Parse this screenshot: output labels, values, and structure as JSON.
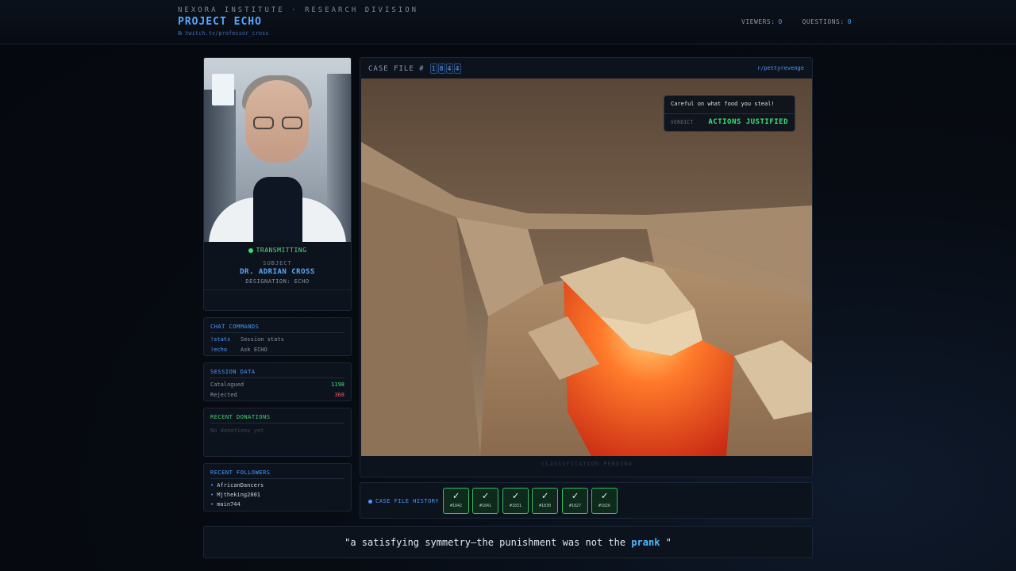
{
  "header": {
    "org": "NEXORA INSTITUTE · RESEARCH DIVISION",
    "project": "PROJECT ECHO",
    "channel": "twitch.tv/professor_cross",
    "viewers_label": "VIEWERS:",
    "viewers": "0",
    "questions_label": "QUESTIONS:",
    "questions": "0"
  },
  "subject": {
    "status": "TRANSMITTING",
    "label": "SUBJECT",
    "name": "DR. ADRIAN CROSS",
    "designation": "DESIGNATION: ECHO"
  },
  "chat_commands": {
    "title": "CHAT COMMANDS",
    "items": [
      {
        "cmd": "!stats",
        "desc": "Session stats"
      },
      {
        "cmd": "!echo",
        "desc": "Ask ECHO"
      }
    ]
  },
  "session_data": {
    "title": "SESSION DATA",
    "catalogued_label": "Catalogued",
    "catalogued": "1198",
    "rejected_label": "Rejected",
    "rejected": "368"
  },
  "donations": {
    "title": "RECENT DONATIONS",
    "empty": "No donations yet"
  },
  "followers": {
    "title": "RECENT FOLLOWERS",
    "items": [
      "AfricanDancers",
      "Mjtheking2001",
      "main744"
    ]
  },
  "case_file": {
    "label": "CASE FILE #",
    "digits": [
      "1",
      "8",
      "4",
      "4"
    ],
    "subreddit": "r/pettyrevenge",
    "quote": "Careful on what food you steal!",
    "verdict_label": "VERDICT",
    "verdict": "ACTIONS JUSTIFIED",
    "footer": "CLASSIFICATION PENDING"
  },
  "history": {
    "label": "CASE FILE HISTORY",
    "items": [
      {
        "check": "✓",
        "id": "#1842"
      },
      {
        "check": "✓",
        "id": "#1841"
      },
      {
        "check": "✓",
        "id": "#1831"
      },
      {
        "check": "✓",
        "id": "#1830"
      },
      {
        "check": "✓",
        "id": "#1827"
      },
      {
        "check": "✓",
        "id": "#1826"
      }
    ]
  },
  "caption": {
    "before": "\"a satisfying symmetry—the punishment was not the ",
    "highlight": "prank",
    "after": " \""
  },
  "colors": {
    "accent": "#4b9bff",
    "success": "#3ee07a",
    "danger": "#e05a6a",
    "background": "#070b12"
  }
}
